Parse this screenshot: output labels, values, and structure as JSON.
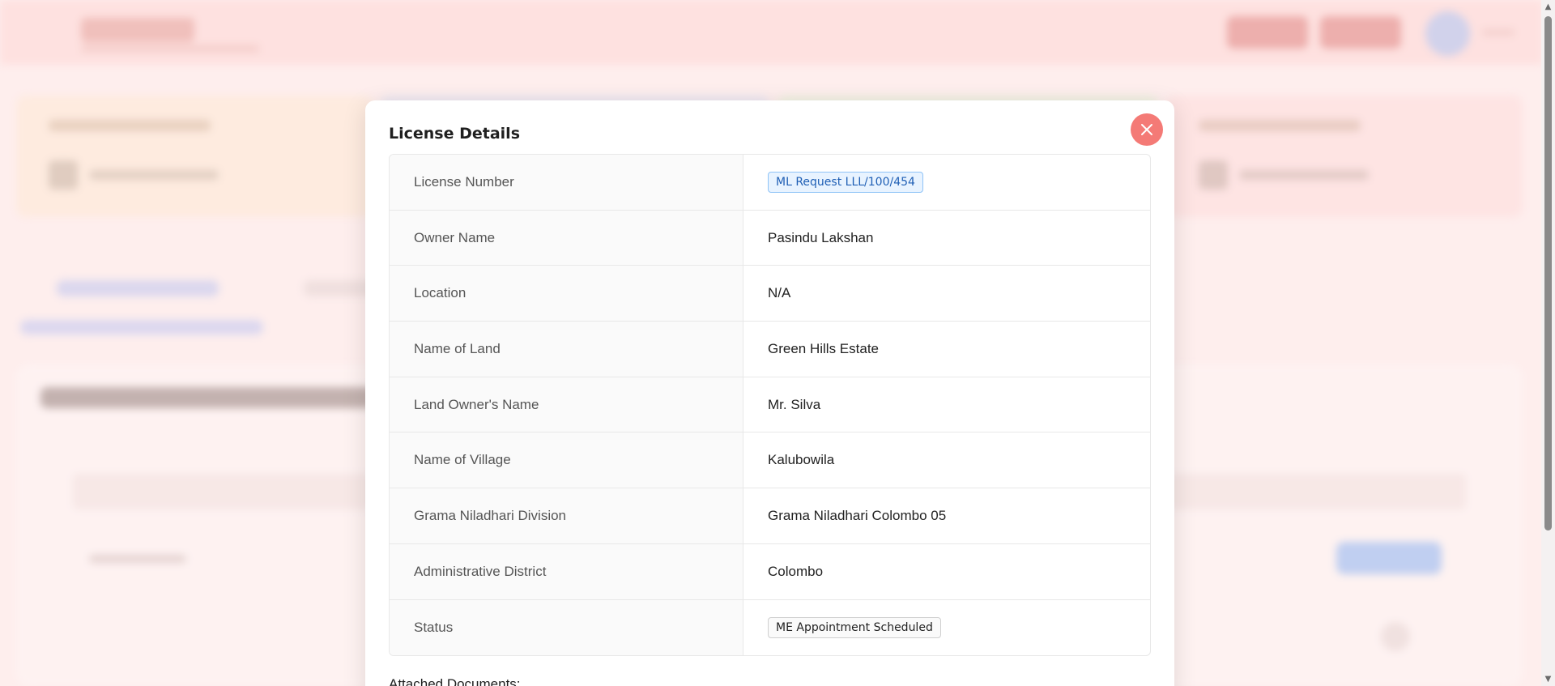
{
  "modal": {
    "title": "License Details",
    "close_icon": "close-icon",
    "rows": [
      {
        "label": "License Number",
        "value": "ML Request LLL/100/454",
        "style": "tag-blue"
      },
      {
        "label": "Owner Name",
        "value": "Pasindu Lakshan",
        "style": "text"
      },
      {
        "label": "Location",
        "value": "N/A",
        "style": "text"
      },
      {
        "label": "Name of Land",
        "value": "Green Hills Estate",
        "style": "text"
      },
      {
        "label": "Land Owner's Name",
        "value": "Mr. Silva",
        "style": "text"
      },
      {
        "label": "Name of Village",
        "value": "Kalubowila",
        "style": "text"
      },
      {
        "label": "Grama Niladhari Division",
        "value": "Grama Niladhari Colombo 05",
        "style": "text"
      },
      {
        "label": "Administrative District",
        "value": "Colombo",
        "style": "text"
      },
      {
        "label": "Status",
        "value": "ME Appointment Scheduled",
        "style": "tag-plain"
      }
    ],
    "attached_documents_label": "Attached Documents:"
  },
  "colors": {
    "close_button": "#f47a76",
    "license_tag_text": "#1f5fb5",
    "license_tag_border": "#8ec3f7",
    "license_tag_bg": "#e8f3ff",
    "header_bg": "#fddcda"
  }
}
